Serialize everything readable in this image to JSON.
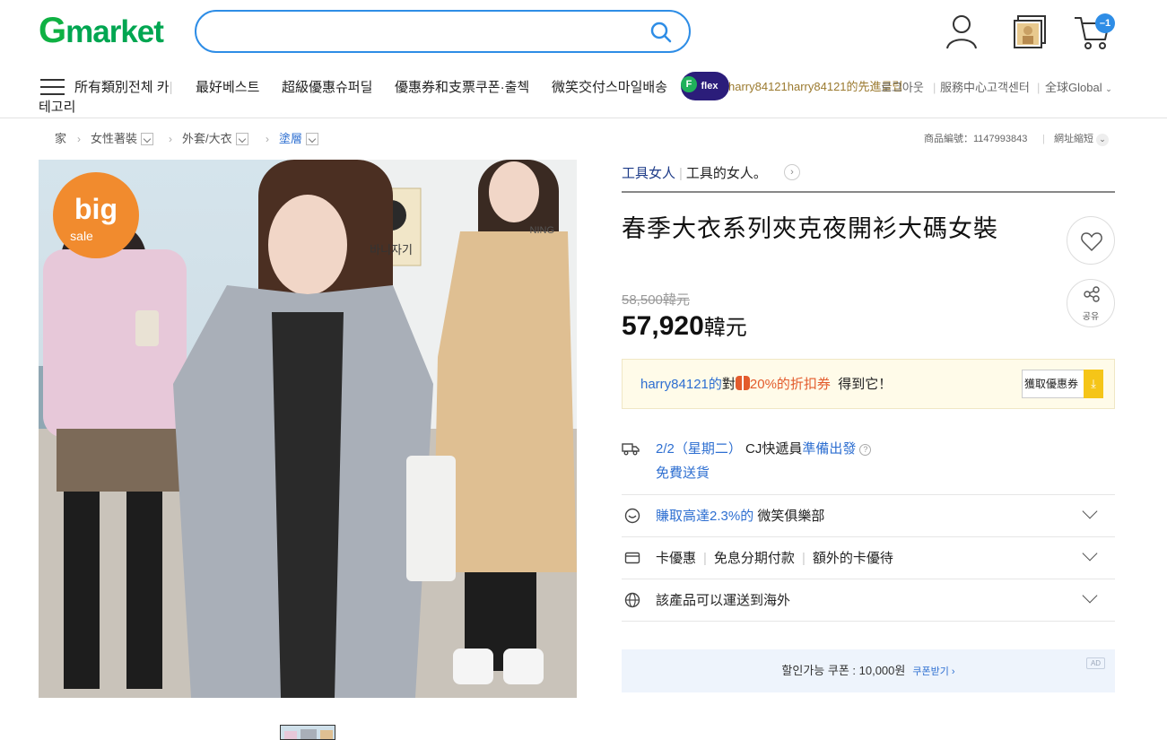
{
  "header": {
    "logo_g": "G",
    "logo_rest": "market",
    "search_value": "",
    "cart_count": "1",
    "icons": [
      "user-icon",
      "recent-items-icon",
      "cart-icon",
      "search-icon"
    ]
  },
  "nav": {
    "category_line1": "所有類別전체 카",
    "category_line2": "테고리",
    "items": [
      "最好베스트",
      "超級優惠슈퍼딜",
      "優惠券和支票쿠폰·출첵",
      "微笑交付스마일배송"
    ],
    "promo_text": "harry84121harry84121的先進클럽",
    "badge_f": "F",
    "badge_label": "flex",
    "logout": "로그아웃",
    "service": "服務中心고객센터",
    "global": "全球Global"
  },
  "breadcrumb": {
    "home": "家",
    "level1": "女性著裝",
    "level2": "外套/大衣",
    "level3": "塗層",
    "product_no": "商品編號：1147993843",
    "shorten": "網址縮短"
  },
  "product": {
    "shop_name": "工具女人",
    "shop_slogan": "工具的女人。",
    "title": "春季大衣系列夾克夜開衫大碼女裝",
    "share_label": "공유",
    "original_price": "58,500韓元",
    "price_number": "57,920",
    "price_unit": "韓元",
    "photo_badge_big": "big",
    "photo_badge_sale": "sale",
    "photo_sign": "바니자기",
    "photo_text": "NING"
  },
  "coupon": {
    "user": "harry84121的",
    "mid": "對",
    "pct": "20%的折扣券",
    "tail": "得到它！",
    "button": "獲取優惠券"
  },
  "shipping": {
    "date": "2/2（星期二）",
    "carrier": "CJ快遞員",
    "status": "準備出發",
    "free": "免費送貨"
  },
  "rows": {
    "smile_blue": "賺取高達2.3%的",
    "smile_rest": "微笑俱樂部",
    "card_a": "卡優惠",
    "card_b": "免息分期付款",
    "card_c": "額外的卡優待",
    "overseas": "該產品可以運送到海外"
  },
  "ad": {
    "text": "할인가능 쿠폰 : 10,000원",
    "link": "쿠폰받기 ›",
    "tag": "AD"
  },
  "colors": {
    "brand_green": "#00a651",
    "accent_blue": "#2e8de6",
    "coupon_orange": "#e35b2c",
    "coupon_yellow": "#f5c518"
  }
}
